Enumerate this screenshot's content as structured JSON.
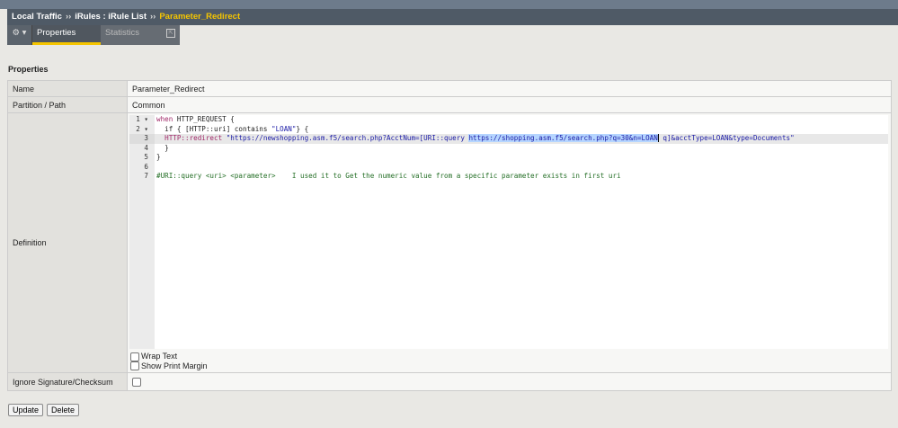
{
  "breadcrumb": {
    "items": [
      "Local Traffic",
      "iRules : iRule List"
    ],
    "separator": "››",
    "current": "Parameter_Redirect"
  },
  "tabs": {
    "gear": "⚙ ▾",
    "properties": "Properties",
    "statistics": "Statistics",
    "popout": "⇱"
  },
  "section_title": "Properties",
  "fields": {
    "name_label": "Name",
    "name_value": "Parameter_Redirect",
    "partition_label": "Partition / Path",
    "partition_value": "Common",
    "definition_label": "Definition",
    "ignore_label": "Ignore Signature/Checksum"
  },
  "editor": {
    "line_numbers": [
      "1 ▾",
      "2 ▾",
      "3",
      "4",
      "5",
      "6",
      "7"
    ],
    "l1a": "when",
    "l1b": " HTTP_REQUEST {",
    "l2a": "  if { [HTTP::uri] contains ",
    "l2b": "\"LOAN\"",
    "l2c": "} {",
    "l3a": "  HTTP::redirect ",
    "l3b": "\"https://newshopping.asm.f5/search.php?AcctNum=[URI::query ",
    "l3sel": "https://shopping.asm.f5/search.php?q=30&n=LOAN",
    "l3c": " q]&acctType=LOAN&type=Documents\"",
    "l4": "  }",
    "l5": "}",
    "l6": "",
    "l7": "#URI::query <uri> <parameter>    I used it to Get the numeric value from a specific parameter exists in first uri"
  },
  "options": {
    "wrap_text": "Wrap Text",
    "show_print_margin": "Show Print Margin"
  },
  "buttons": {
    "update": "Update",
    "delete": "Delete"
  }
}
